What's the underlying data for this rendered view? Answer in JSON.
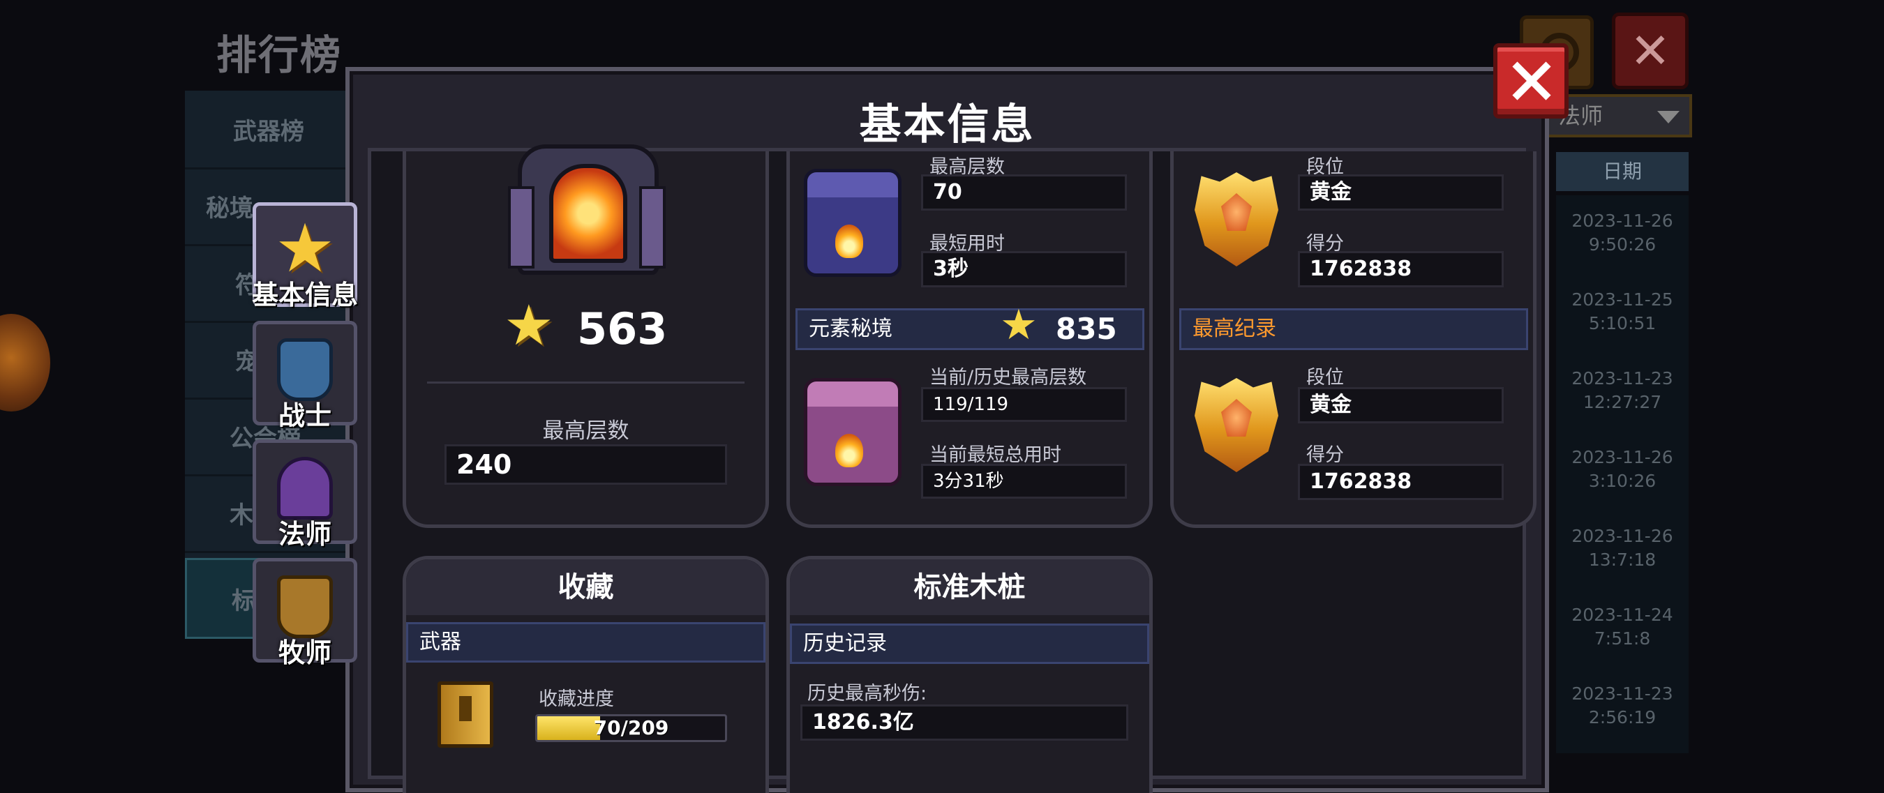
{
  "background": {
    "title": "排行榜",
    "tabs": [
      "武器榜",
      "秘境",
      "符",
      "宠",
      "公会榜",
      "木",
      "标"
    ],
    "class_select": "法师",
    "date_header": "日期",
    "dates": [
      [
        "2023-11-26",
        "9:50:26"
      ],
      [
        "2023-11-25",
        "5:10:51"
      ],
      [
        "2023-11-23",
        "12:27:27"
      ],
      [
        "2023-11-26",
        "3:10:26"
      ],
      [
        "2023-11-26",
        "13:7:18"
      ],
      [
        "2023-11-24",
        "7:51:8"
      ],
      [
        "2023-11-23",
        "2:56:19"
      ]
    ]
  },
  "modal": {
    "title": "基本信息",
    "side_tabs": [
      "基本信息",
      "战士",
      "法师",
      "牧师"
    ],
    "tower": {
      "stars": "563",
      "max_floor_label": "最高层数",
      "max_floor": "240"
    },
    "trial": {
      "max_floor_label": "最高层数",
      "max_floor": "70",
      "min_time_label": "最短用时",
      "min_time": "3秒",
      "elemental_label": "元素秘境",
      "elemental_stars": "835",
      "current_max_label": "当前/历史最高层数",
      "current_max": "119/119",
      "total_time_label": "当前最短总用时",
      "total_time": "3分31秒"
    },
    "rank": {
      "tier_label": "段位",
      "tier": "黄金",
      "score_label": "得分",
      "score": "1762838",
      "record_head": "最高纪录",
      "record_tier_label": "段位",
      "record_tier": "黄金",
      "record_score_label": "得分",
      "record_score": "1762838"
    },
    "collection": {
      "title": "收藏",
      "section": "武器",
      "progress_label": "收藏进度",
      "progress_text": "70/209",
      "progress_value": 0.335
    },
    "dummy": {
      "title": "标准木桩",
      "section": "历史记录",
      "dps_label": "历史最高秒伤:",
      "dps": "1826.3亿"
    }
  },
  "colors": {
    "accent_gold": "#f0d24a",
    "record_orange": "#ff9a2e",
    "close_red": "#c92a2a"
  },
  "icons": [
    "star-icon",
    "tower-icon",
    "cauldron-blue-icon",
    "cauldron-pink-icon",
    "gold-badge-icon",
    "book-icon",
    "warrior-icon",
    "mage-icon",
    "priest-icon",
    "close-icon"
  ]
}
